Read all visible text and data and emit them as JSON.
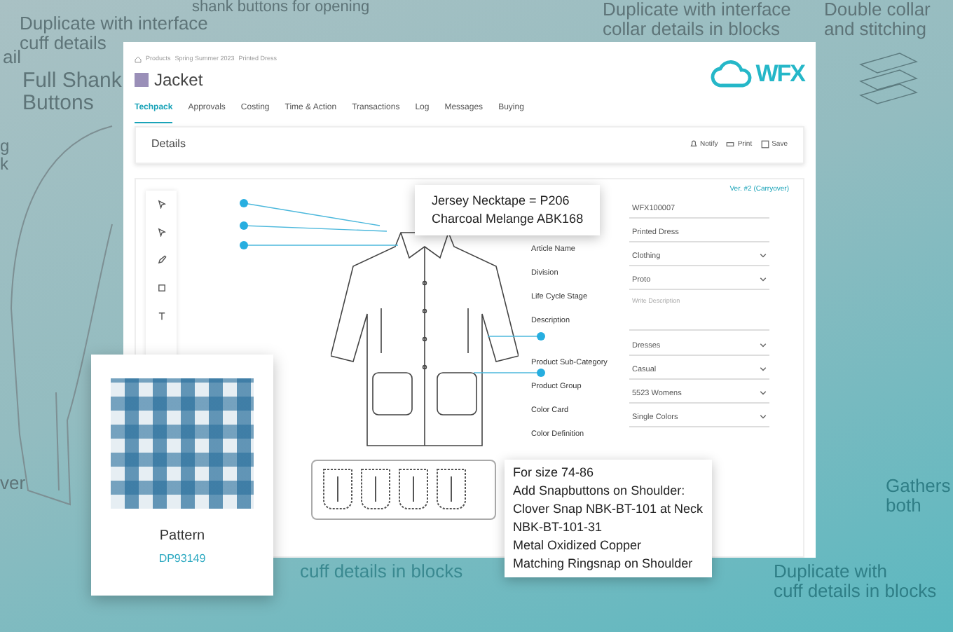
{
  "background_notes": [
    {
      "lines": [
        "ail"
      ]
    },
    {
      "lines": [
        "Duplicate with interface",
        "cuff details"
      ]
    },
    {
      "lines": [
        "Full Shank",
        "Buttons"
      ]
    },
    {
      "lines": [
        "shank buttons for opening"
      ]
    },
    {
      "lines": [
        "g",
        "k"
      ]
    },
    {
      "lines": [
        "ver"
      ]
    },
    {
      "lines": [
        "Duplicate with interface",
        "collar details in blocks"
      ]
    },
    {
      "lines": [
        "Double collar",
        "and stitching"
      ]
    },
    {
      "lines": [
        "Gathers",
        "both"
      ]
    },
    {
      "lines": [
        "cuff details in blocks"
      ]
    },
    {
      "lines": [
        "Duplicate with",
        "cuff details in blocks"
      ]
    }
  ],
  "window": {
    "breadcrumb": [
      "Products",
      "Spring Summer 2023",
      "Printed Dress"
    ],
    "title": "Jacket",
    "logo": "WFX",
    "tabs": [
      {
        "label": "Techpack",
        "selected": true
      },
      {
        "label": "Approvals",
        "selected": false
      },
      {
        "label": "Costing",
        "selected": false
      },
      {
        "label": "Time & Action",
        "selected": false
      },
      {
        "label": "Transactions",
        "selected": false
      },
      {
        "label": "Log",
        "selected": false
      },
      {
        "label": "Messages",
        "selected": false
      },
      {
        "label": "Buying",
        "selected": false
      }
    ],
    "section_title": "Details",
    "actions": [
      {
        "kind": "notify",
        "label": "Notify"
      },
      {
        "kind": "print",
        "label": "Print"
      },
      {
        "kind": "save",
        "label": "Save"
      }
    ],
    "version": "Ver. #2 (Carryover)",
    "form": [
      {
        "kind": "text",
        "value": "WFX100007"
      },
      {
        "kind": "text",
        "label": "Article Name",
        "value": "Printed Dress"
      },
      {
        "kind": "select",
        "label": "Division",
        "value": "Clothing"
      },
      {
        "kind": "select",
        "label": "Life Cycle Stage",
        "value": "Proto"
      },
      {
        "kind": "textarea",
        "label": "Description",
        "placeholder": "Write Description"
      },
      {
        "kind": "select",
        "label": "Product Sub-Category",
        "value": "Dresses"
      },
      {
        "kind": "select",
        "label": "Product Group",
        "value": "Casual"
      },
      {
        "kind": "select",
        "label": "Color Card",
        "value": "5523 Womens"
      },
      {
        "kind": "select",
        "label": "Color Definition",
        "value": "Single Colors"
      }
    ]
  },
  "callouts": [
    {
      "lines": [
        "Jersey Necktape = P206",
        "Charcoal Melange ABK168"
      ]
    },
    {
      "lines": [
        "For size 74-86",
        "Add Snapbuttons on Shoulder:",
        "Clover Snap NBK-BT-101 at Neck",
        "NBK-BT-101-31",
        "Metal Oxidized Copper",
        "Matching Ringsnap on Shoulder"
      ]
    }
  ],
  "pattern_card": {
    "title": "Pattern",
    "code": "DP93149"
  }
}
